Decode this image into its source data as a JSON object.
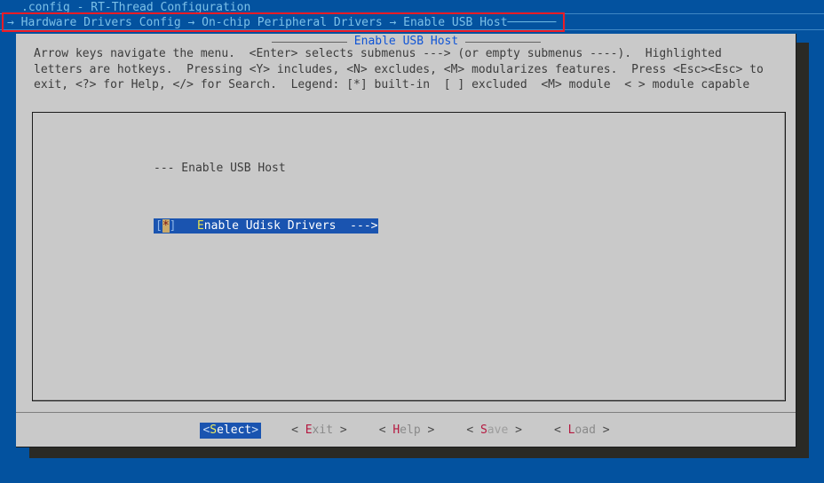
{
  "window": {
    "title": ".config - RT-Thread Configuration"
  },
  "breadcrumb": {
    "arrow": "→",
    "segments": [
      "Hardware Drivers Config",
      "On-chip Peripheral Drivers",
      "Enable USB Host"
    ],
    "full_text": "→ Hardware Drivers Config → On-chip Peripheral Drivers → Enable USB Host",
    "trailing_rule": "───────",
    "annotation_color": "#ee1c25"
  },
  "dialog": {
    "title": "Enable USB Host",
    "title_color": "#1055d6",
    "help_text": "Arrow keys navigate the menu.  <Enter> selects submenus ---> (or empty submenus ----).  Highlighted\nletters are hotkeys.  Pressing <Y> includes, <N> excludes, <M> modularizes features.  Press <Esc><Esc> to\nexit, <?> for Help, </> for Search.  Legend: [*] built-in  [ ] excluded  <M> module  < > module capable"
  },
  "menu": {
    "comment_row": "--- Enable USB Host",
    "items": [
      {
        "state_open": "[",
        "state_mark": "*",
        "state_close": "]",
        "gap": "   ",
        "hotkey": "E",
        "label_rest": "nable Udisk Drivers",
        "submenu_arrow": "  --->",
        "selected": true
      }
    ],
    "highlight_color": "#1a54b0",
    "cursor_color": "#c9a96a"
  },
  "buttons": [
    {
      "open": "<",
      "hotkey": "S",
      "rest": "elect",
      "close": ">",
      "primary": true,
      "dim": false
    },
    {
      "open": "<",
      "hotkey": "E",
      "rest": "xit",
      "close": ">",
      "primary": false,
      "dim": false
    },
    {
      "open": "<",
      "hotkey": "H",
      "rest": "elp",
      "close": ">",
      "primary": false,
      "dim": false
    },
    {
      "open": "<",
      "hotkey": "S",
      "rest": "ave",
      "close": ">",
      "primary": false,
      "dim": true
    },
    {
      "open": "<",
      "hotkey": "L",
      "rest": "oad",
      "close": ">",
      "primary": false,
      "dim": false
    }
  ],
  "colors": {
    "desktop_blue": "#03529f",
    "dialog_grey": "#c9c9c9",
    "shadow": "#2a2a25",
    "text_grey": "#3c3c3c",
    "accent_blue": "#1a54b0",
    "hotkey_red": "#b5183f"
  }
}
